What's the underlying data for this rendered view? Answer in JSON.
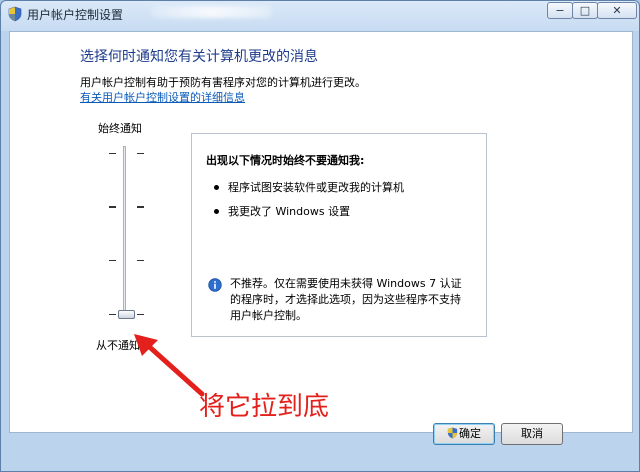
{
  "window": {
    "title": "用户帐户控制设置",
    "controls": {
      "minimize": "−",
      "maximize": "□",
      "close": "✕"
    }
  },
  "main": {
    "heading": "选择何时通知您有关计算机更改的消息",
    "description": "用户帐户控制有助于预防有害程序对您的计算机进行更改。",
    "link": "有关用户帐户控制设置的详细信息"
  },
  "slider": {
    "top_label": "始终通知",
    "bottom_label": "从不通知",
    "level": 0,
    "levels": 4
  },
  "panel": {
    "title": "出现以下情况时始终不要通知我:",
    "bullets": [
      "程序试图安装软件或更改我的计算机",
      "我更改了 Windows 设置"
    ],
    "note": "不推荐。仅在需要使用未获得 Windows 7 认证的程序时，才选择此选项，因为这些程序不支持用户帐户控制。"
  },
  "annotation": {
    "text": "将它拉到底",
    "color": "#e4201c"
  },
  "buttons": {
    "ok": "确定",
    "cancel": "取消"
  },
  "icons": [
    "uac-shield-icon",
    "info-icon",
    "red-arrow-icon"
  ]
}
